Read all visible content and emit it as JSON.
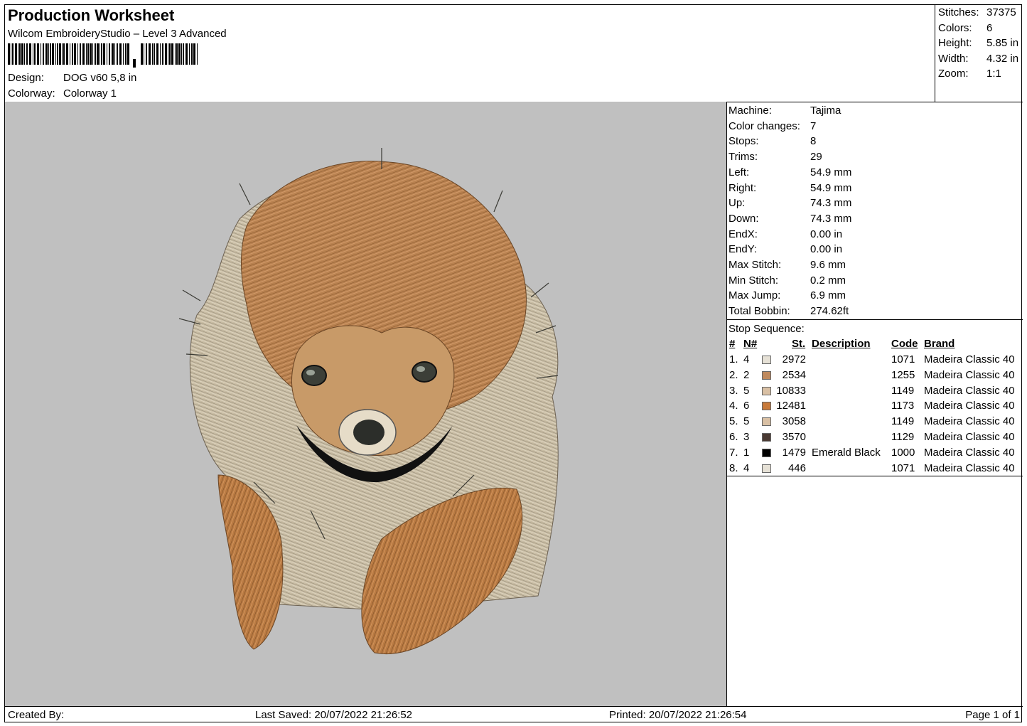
{
  "header": {
    "title": "Production Worksheet",
    "subtitle": "Wilcom EmbroideryStudio – Level 3 Advanced",
    "design_label": "Design:",
    "design_value": "DOG v60 5,8 in",
    "colorway_label": "Colorway:",
    "colorway_value": "Colorway 1"
  },
  "summary": [
    {
      "label": "Stitches:",
      "value": "37375"
    },
    {
      "label": "Colors:",
      "value": "6"
    },
    {
      "label": "Height:",
      "value": "5.85 in"
    },
    {
      "label": "Width:",
      "value": "4.32 in"
    },
    {
      "label": "Zoom:",
      "value": "1:1"
    }
  ],
  "machine_info": [
    {
      "label": "Machine:",
      "value": "Tajima"
    },
    {
      "label": "Color changes:",
      "value": "7"
    },
    {
      "label": "Stops:",
      "value": "8"
    },
    {
      "label": "Trims:",
      "value": "29"
    },
    {
      "label": "Left:",
      "value": "54.9 mm"
    },
    {
      "label": "Right:",
      "value": "54.9 mm"
    },
    {
      "label": "Up:",
      "value": "74.3 mm"
    },
    {
      "label": "Down:",
      "value": "74.3 mm"
    },
    {
      "label": "EndX:",
      "value": "0.00 in"
    },
    {
      "label": "EndY:",
      "value": "0.00 in"
    },
    {
      "label": "Max Stitch:",
      "value": "9.6 mm"
    },
    {
      "label": "Min Stitch:",
      "value": "0.2 mm"
    },
    {
      "label": "Max Jump:",
      "value": "6.9 mm"
    },
    {
      "label": "Total Bobbin:",
      "value": "274.62ft"
    }
  ],
  "stop_sequence": {
    "title": "Stop Sequence:",
    "headers": {
      "num": "#",
      "needle": "N#",
      "stitches": "St.",
      "description": "Description",
      "code": "Code",
      "brand": "Brand"
    },
    "rows": [
      {
        "num": "1.",
        "needle": "4",
        "color": "#e6e1d6",
        "stitches": "2972",
        "description": "",
        "code": "1071",
        "brand": "Madeira Classic 40"
      },
      {
        "num": "2.",
        "needle": "2",
        "color": "#c08a5e",
        "stitches": "2534",
        "description": "",
        "code": "1255",
        "brand": "Madeira Classic 40"
      },
      {
        "num": "3.",
        "needle": "5",
        "color": "#d9c0a4",
        "stitches": "10833",
        "description": "",
        "code": "1149",
        "brand": "Madeira Classic 40"
      },
      {
        "num": "4.",
        "needle": "6",
        "color": "#c87a3a",
        "stitches": "12481",
        "description": "",
        "code": "1173",
        "brand": "Madeira Classic 40"
      },
      {
        "num": "5.",
        "needle": "5",
        "color": "#d9c0a4",
        "stitches": "3058",
        "description": "",
        "code": "1149",
        "brand": "Madeira Classic 40"
      },
      {
        "num": "6.",
        "needle": "3",
        "color": "#4a3a33",
        "stitches": "3570",
        "description": "",
        "code": "1129",
        "brand": "Madeira Classic 40"
      },
      {
        "num": "7.",
        "needle": "1",
        "color": "#000000",
        "stitches": "1479",
        "description": "Emerald Black",
        "code": "1000",
        "brand": "Madeira Classic 40"
      },
      {
        "num": "8.",
        "needle": "4",
        "color": "#e6e1d6",
        "stitches": "446",
        "description": "",
        "code": "1071",
        "brand": "Madeira Classic 40"
      }
    ]
  },
  "footer": {
    "created_by": "Created By:",
    "last_saved": "Last Saved: 20/07/2022 21:26:52",
    "printed": "Printed: 20/07/2022 21:26:54",
    "page": "Page 1 of 1"
  }
}
